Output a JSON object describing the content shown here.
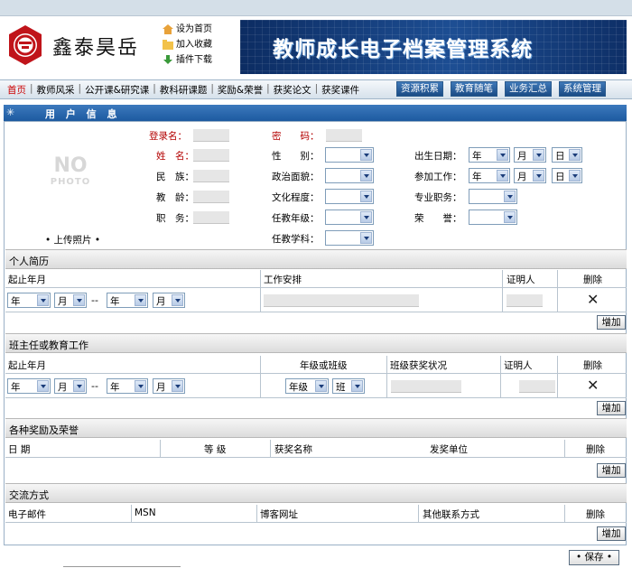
{
  "header": {
    "logo_text": "鑫泰昊岳",
    "quick_links": [
      "设为首页",
      "加入收藏",
      "插件下载"
    ],
    "banner_title": "教师成长电子档案管理系统"
  },
  "nav": {
    "left_items": [
      "首页",
      "教师风采",
      "公开课&研究课",
      "教科研课题",
      "奖励&荣誉",
      "获奖论文",
      "获奖课件"
    ],
    "right_buttons": [
      "资源积累",
      "教育随笔",
      "业务汇总",
      "系统管理"
    ]
  },
  "user_section": {
    "title": "用 户 信 息",
    "photo_no": "NO",
    "photo_sub": "PHOTO",
    "upload": "• 上传照片 •",
    "labels": {
      "login": "登录名：",
      "password": "密　　码：",
      "name": "姓　名：",
      "gender": "性　　别：",
      "birth": "出生日期：",
      "ethnic": "民　族：",
      "political": "政治面貌：",
      "work_start": "参加工作：",
      "teach_age": "教　龄：",
      "education": "文化程度：",
      "title": "专业职务：",
      "duty": "职　务：",
      "grade": "任教年级：",
      "honor": "荣　　誉：",
      "subject": "任教学科："
    },
    "date_selects": {
      "year": "年",
      "month": "月",
      "day": "日"
    }
  },
  "resume": {
    "title": "个人简历",
    "headers": [
      "起止年月",
      "工作安排",
      "证明人",
      "删除"
    ],
    "row": {
      "from_year": "年",
      "from_month": "月",
      "dash": "--",
      "to_year": "年",
      "to_month": "月"
    },
    "add": "增加"
  },
  "class_teacher": {
    "title": "班主任或教育工作",
    "headers": [
      "起止年月",
      "年级或班级",
      "班级获奖状况",
      "证明人",
      "删除"
    ],
    "row": {
      "from_year": "年",
      "from_month": "月",
      "dash": "--",
      "to_year": "年",
      "to_month": "月",
      "grade": "年级",
      "class": "班"
    },
    "add": "增加"
  },
  "awards": {
    "title": "各种奖励及荣誉",
    "headers": [
      "日 期",
      "等 级",
      "获奖名称",
      "发奖单位",
      "删除"
    ],
    "add": "增加"
  },
  "contact": {
    "title": "交流方式",
    "headers": [
      "电子邮件",
      "MSN",
      "博客网址",
      "其他联系方式",
      "删除"
    ],
    "add": "增加"
  },
  "save": "• 保存 •"
}
